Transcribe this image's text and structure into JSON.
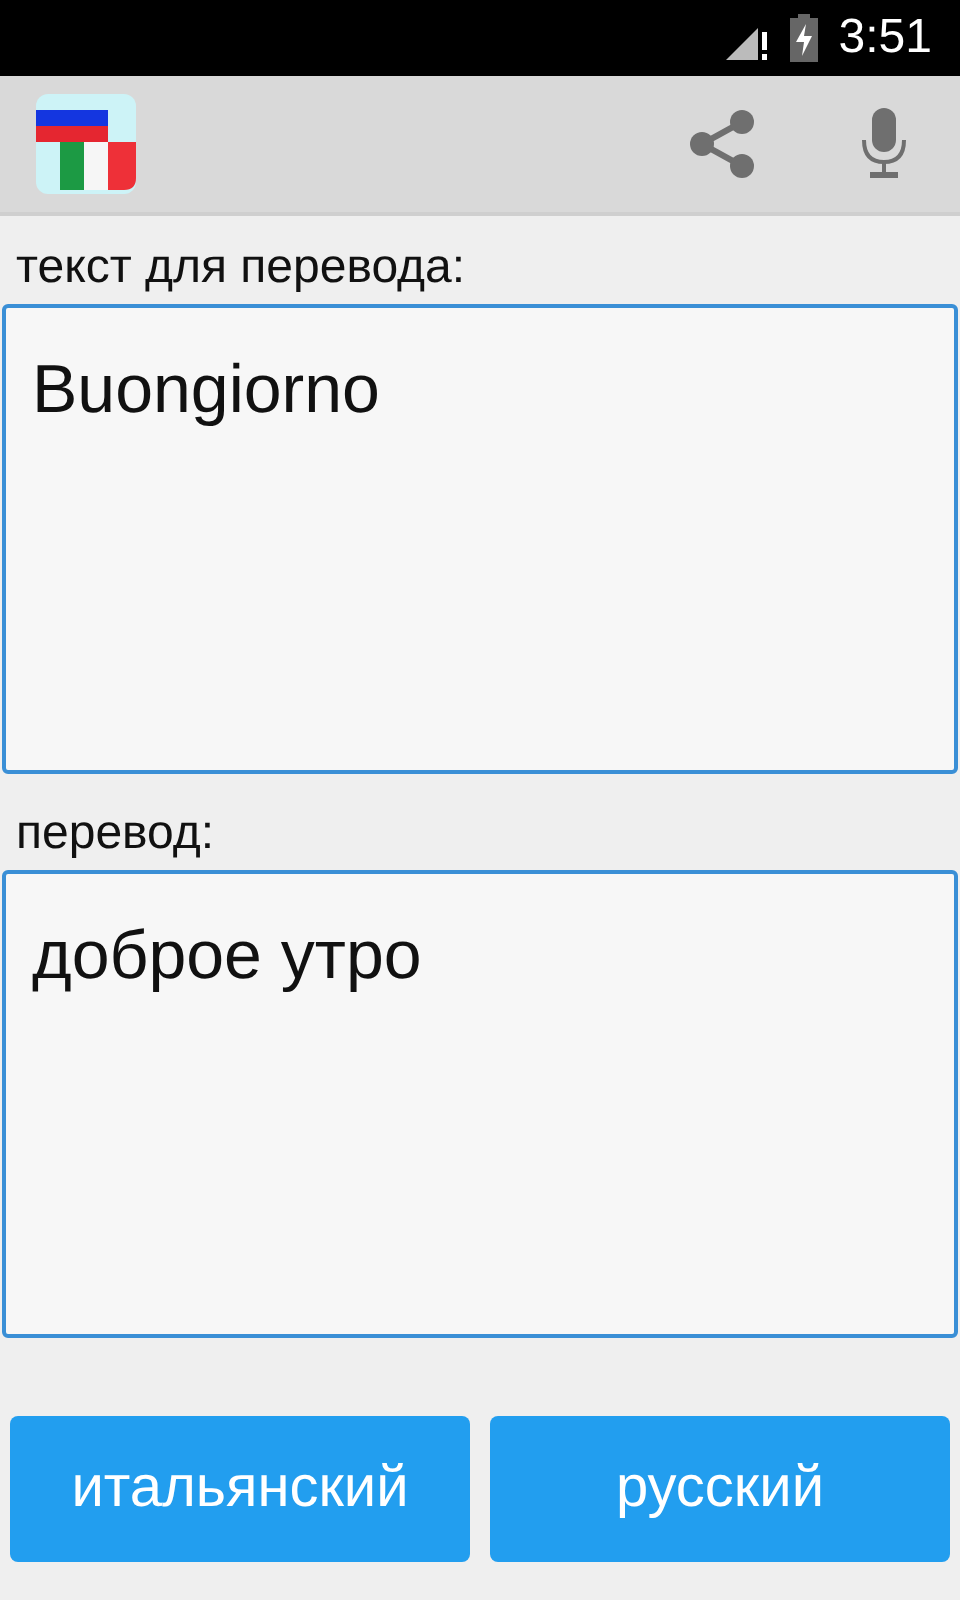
{
  "status_bar": {
    "time": "3:51"
  },
  "source": {
    "label": "текст для перевода:",
    "value": "Buongiorno"
  },
  "target": {
    "label": "перевод:",
    "value": "доброе утро"
  },
  "buttons": [
    {
      "label": "итальянский"
    },
    {
      "label": "русский"
    }
  ]
}
